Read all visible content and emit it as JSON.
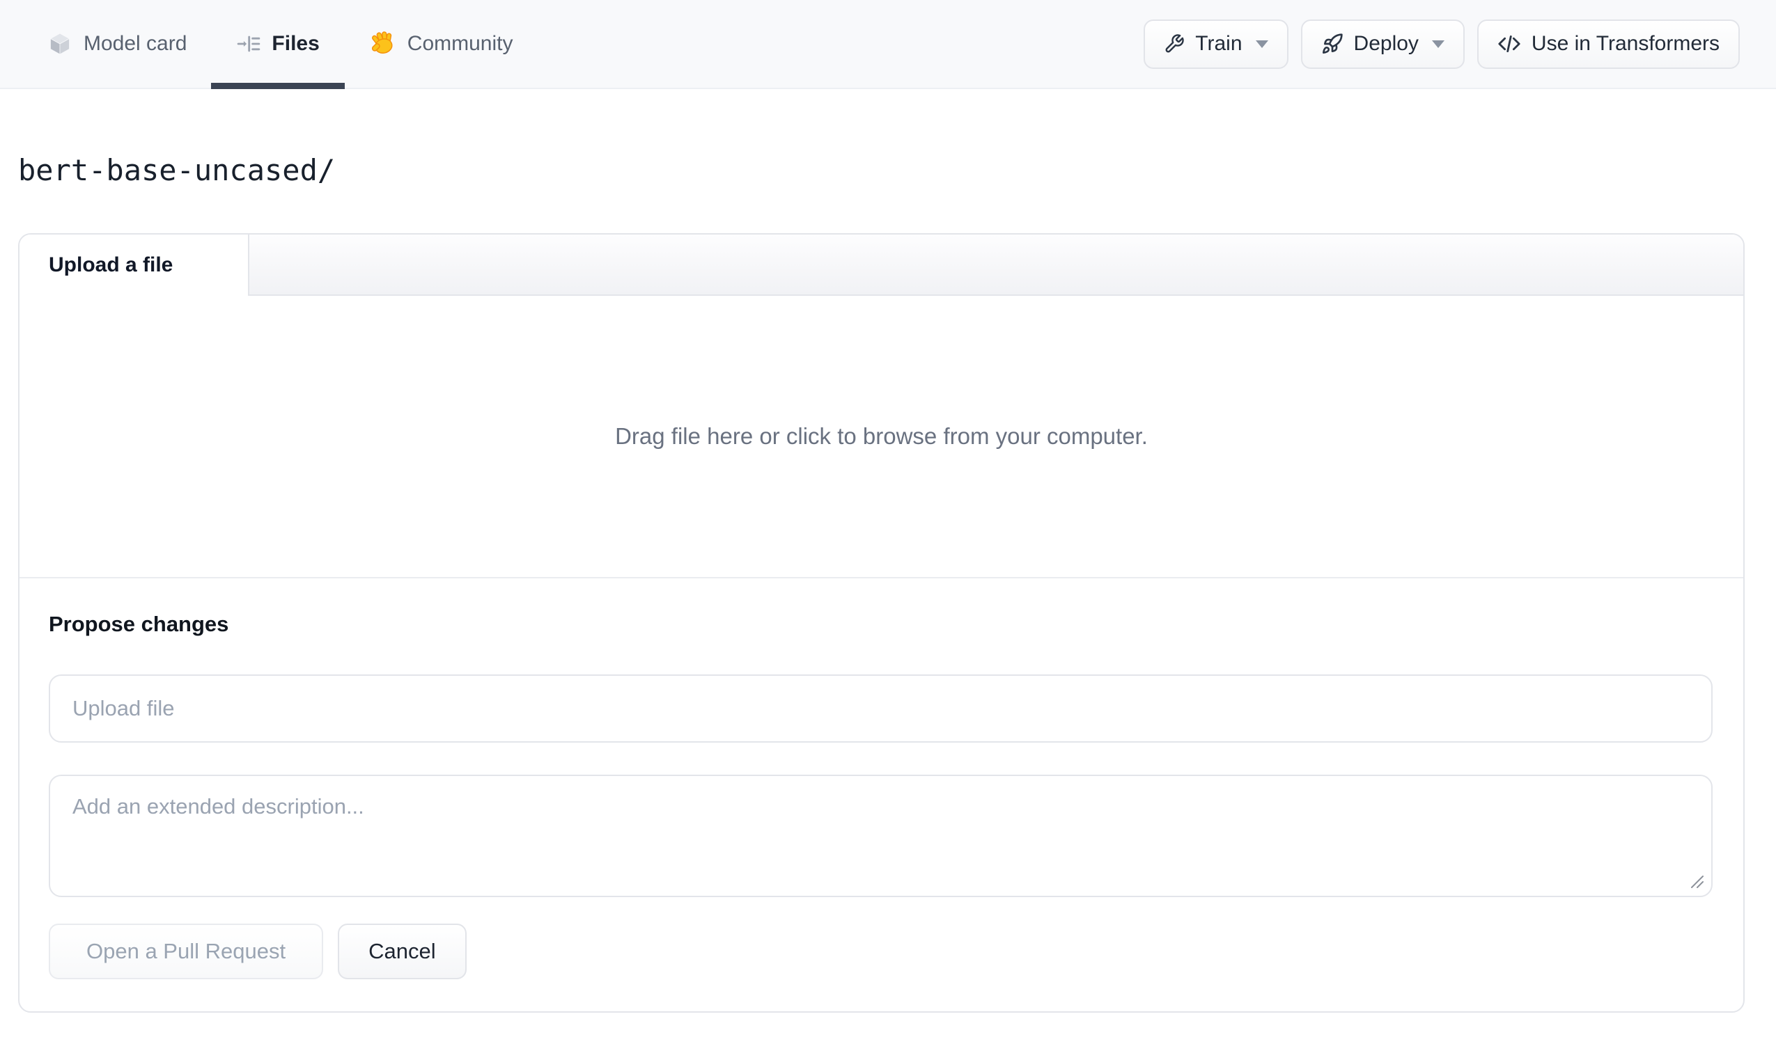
{
  "nav": {
    "tabs": [
      {
        "label": "Model card",
        "icon": "cube-icon",
        "active": false
      },
      {
        "label": "Files",
        "icon": "file-versions-icon",
        "active": true
      },
      {
        "label": "Community",
        "icon": "waving-hand-icon",
        "active": false
      }
    ],
    "actions": [
      {
        "label": "Train",
        "icon": "wrench-icon",
        "has_dropdown": true
      },
      {
        "label": "Deploy",
        "icon": "rocket-icon",
        "has_dropdown": true
      },
      {
        "label": "Use in Transformers",
        "icon": "code-icon",
        "has_dropdown": false
      }
    ]
  },
  "breadcrumb": {
    "path": "bert-base-uncased/"
  },
  "upload_card": {
    "tab_label": "Upload a file",
    "dropzone_text": "Drag file here or click to browse from your computer.",
    "propose": {
      "heading": "Propose changes",
      "filename_placeholder": "Upload file",
      "description_placeholder": "Add an extended description...",
      "primary_button": "Open a Pull Request",
      "cancel_button": "Cancel"
    }
  },
  "colors": {
    "navbar_bg": "#f8f9fb",
    "active_tab_underline": "#3b4454",
    "nav_inactive_text": "#58616f",
    "card_border": "#e3e5ea",
    "muted_text": "#697180",
    "placeholder_text": "#9aa3b1",
    "disabled_button_text": "#9aa4b2",
    "emoji_hand": "#fcc21b"
  }
}
